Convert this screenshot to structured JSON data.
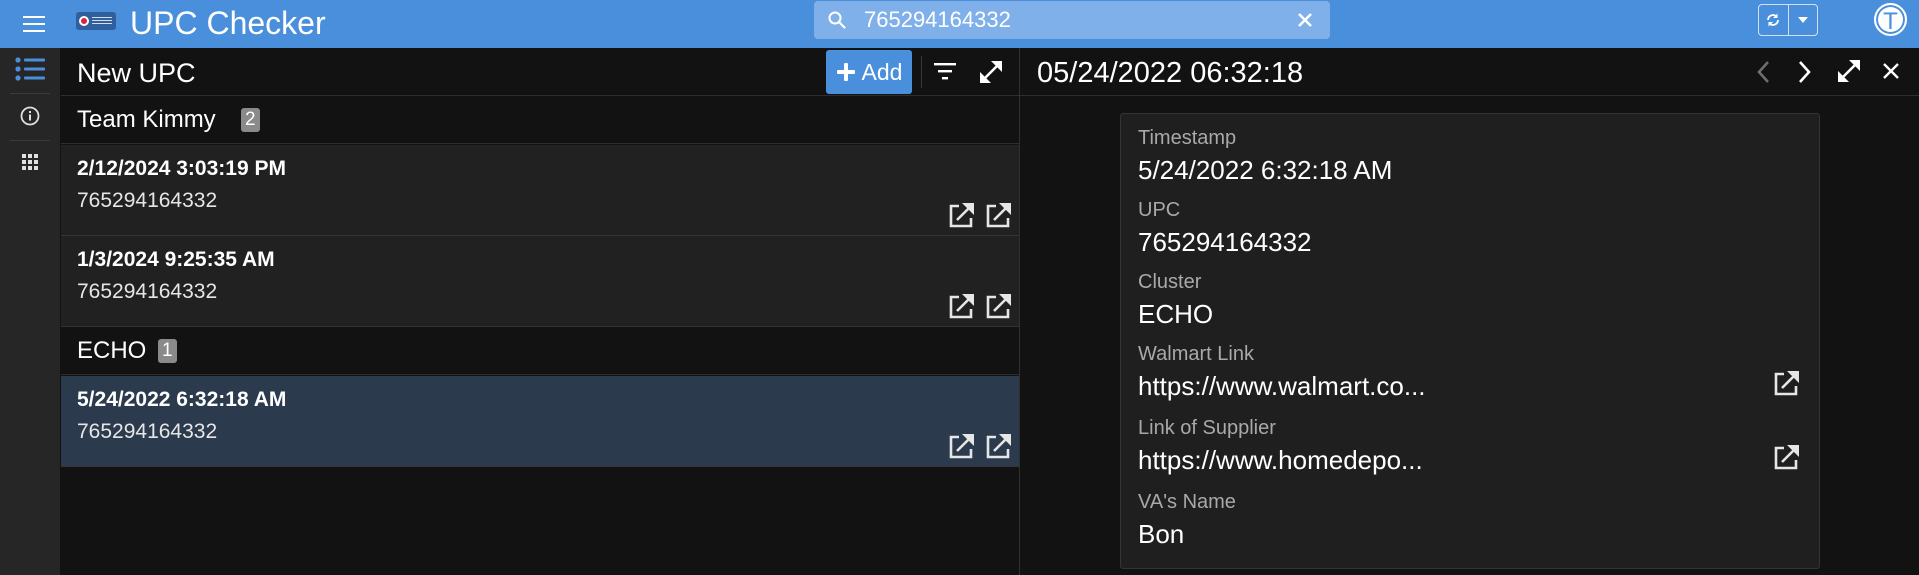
{
  "app": {
    "title": "UPC Checker",
    "accent": "#4a8fdb",
    "logo_icon": "company-logo-icon"
  },
  "search": {
    "value": "765294164332",
    "placeholder": ""
  },
  "user": {
    "avatar_initial": "T"
  },
  "rail": {
    "items": [
      {
        "icon": "list-icon",
        "active": true
      },
      {
        "icon": "info-icon",
        "active": false
      },
      {
        "icon": "apps-grid-icon",
        "active": false
      }
    ]
  },
  "list": {
    "title": "New UPC",
    "add_label": "Add",
    "groups": [
      {
        "name": "Team Kimmy",
        "count": "2",
        "rows": [
          {
            "date": "2/12/2024 3:03:19 PM",
            "upc": "765294164332"
          },
          {
            "date": "1/3/2024 9:25:35 AM",
            "upc": "765294164332"
          }
        ]
      },
      {
        "name": "ECHO",
        "count": "1",
        "rows": [
          {
            "date": "5/24/2022 6:32:18 AM",
            "upc": "765294164332",
            "selected": true
          }
        ]
      }
    ]
  },
  "detail": {
    "title": "05/24/2022 06:32:18",
    "fields": [
      {
        "label": "Timestamp",
        "value": "5/24/2022 6:32:18 AM"
      },
      {
        "label": "UPC",
        "value": "765294164332"
      },
      {
        "label": "Cluster",
        "value": "ECHO"
      },
      {
        "label": "Walmart Link",
        "value": "https://www.walmart.co..."
      },
      {
        "label": "Link of Supplier",
        "value": "https://www.homedepo..."
      },
      {
        "label": "VA's Name",
        "value": "Bon"
      }
    ]
  }
}
